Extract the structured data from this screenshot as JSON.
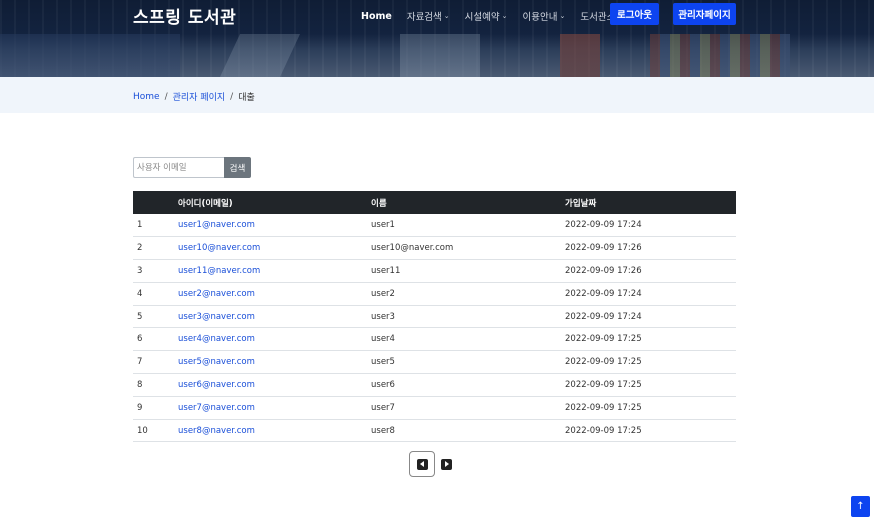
{
  "header": {
    "brand": "스프링 도서관",
    "nav": [
      {
        "label": "Home",
        "active": true,
        "dropdown": false
      },
      {
        "label": "자료검색",
        "active": false,
        "dropdown": true
      },
      {
        "label": "시설예약",
        "active": false,
        "dropdown": true
      },
      {
        "label": "이용안내",
        "active": false,
        "dropdown": true
      },
      {
        "label": "도서관소식",
        "active": false,
        "dropdown": true
      }
    ],
    "logout_label": "로그아웃",
    "admin_label": "관리자페이지"
  },
  "breadcrumb": {
    "home": "Home",
    "admin": "관리자 페이지",
    "current": "대출",
    "separator": "/"
  },
  "search": {
    "placeholder": "사용자 이메일",
    "value": "",
    "button_label": "검색"
  },
  "table": {
    "columns": [
      "",
      "아이디(이메일)",
      "이름",
      "가입날짜"
    ],
    "rows": [
      {
        "no": "1",
        "email": "user1@naver.com",
        "name": "user1",
        "joined": "2022-09-09 17:24"
      },
      {
        "no": "2",
        "email": "user10@naver.com",
        "name": "user10@naver.com",
        "joined": "2022-09-09 17:26"
      },
      {
        "no": "3",
        "email": "user11@naver.com",
        "name": "user11",
        "joined": "2022-09-09 17:26"
      },
      {
        "no": "4",
        "email": "user2@naver.com",
        "name": "user2",
        "joined": "2022-09-09 17:24"
      },
      {
        "no": "5",
        "email": "user3@naver.com",
        "name": "user3",
        "joined": "2022-09-09 17:24"
      },
      {
        "no": "6",
        "email": "user4@naver.com",
        "name": "user4",
        "joined": "2022-09-09 17:25"
      },
      {
        "no": "7",
        "email": "user5@naver.com",
        "name": "user5",
        "joined": "2022-09-09 17:25"
      },
      {
        "no": "8",
        "email": "user6@naver.com",
        "name": "user6",
        "joined": "2022-09-09 17:25"
      },
      {
        "no": "9",
        "email": "user7@naver.com",
        "name": "user7",
        "joined": "2022-09-09 17:25"
      },
      {
        "no": "10",
        "email": "user8@naver.com",
        "name": "user8",
        "joined": "2022-09-09 17:25"
      }
    ]
  },
  "pagination": {
    "prev_icon": "caret-left-square-icon",
    "next_icon": "caret-right-square-icon"
  },
  "back_to_top": {
    "icon": "arrow-up-icon",
    "glyph": "↑"
  },
  "colors": {
    "primary": "#0d44f0",
    "link": "#1a4fd8",
    "table_header": "#212529",
    "breadcrumb_bg": "#f0f5fb"
  }
}
